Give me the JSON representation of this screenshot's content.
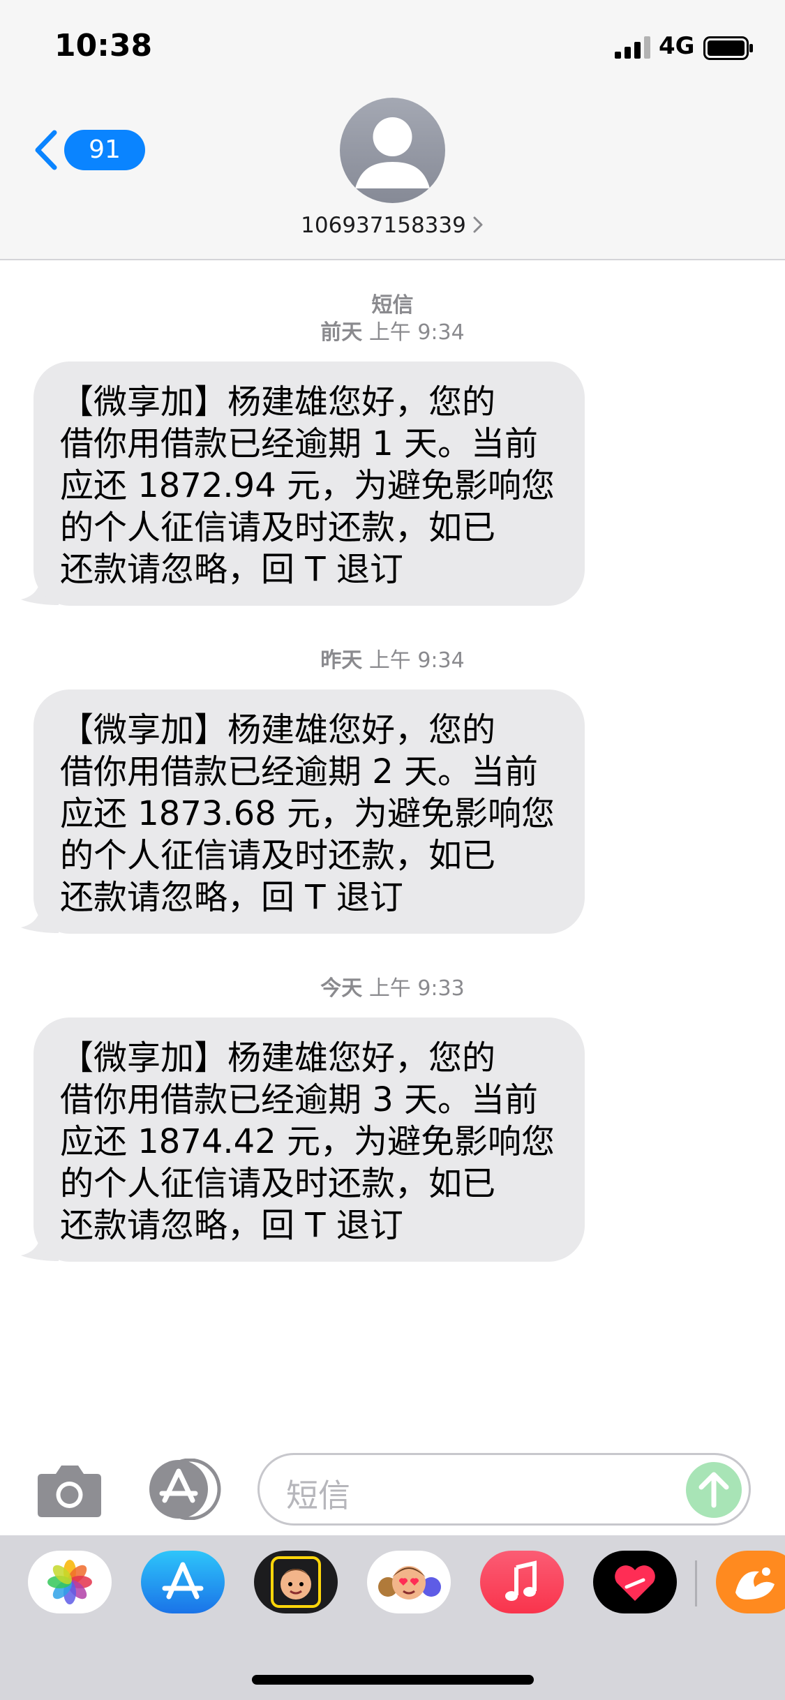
{
  "status_bar": {
    "time": "10:38",
    "network": "4G"
  },
  "nav": {
    "back_count": "91",
    "contact": "106937158339"
  },
  "thread": {
    "service_label": "短信",
    "messages": [
      {
        "day": "前天",
        "time": "上午 9:34",
        "lines": [
          "【微享加】杨建雄您好，您的",
          "借你用借款已经逾期 1 天。当前",
          "应还 1872.94 元，为避免影响您",
          "的个人征信请及时还款，如已",
          "还款请忽略，回 T 退订"
        ]
      },
      {
        "day": "昨天",
        "time": "上午 9:34",
        "lines": [
          "【微享加】杨建雄您好，您的",
          "借你用借款已经逾期 2 天。当前",
          "应还 1873.68 元，为避免影响您",
          "的个人征信请及时还款，如已",
          "还款请忽略，回 T 退订"
        ]
      },
      {
        "day": "今天",
        "time": "上午 9:33",
        "lines": [
          "【微享加】杨建雄您好，您的",
          "借你用借款已经逾期 3 天。当前",
          "应还 1874.42 元，为避免影响您",
          "的个人征信请及时还款，如已",
          "还款请忽略，回 T 退订"
        ]
      }
    ]
  },
  "compose": {
    "placeholder": "短信"
  },
  "app_drawer": {
    "apps": [
      "photos-icon",
      "app-store-icon",
      "memoji-camera-icon",
      "animoji-icon",
      "music-icon",
      "digital-touch-icon",
      "uc-browser-icon"
    ]
  },
  "colors": {
    "accent": "#0a84ff",
    "bubble": "#e9e9eb",
    "send": "#a8e4b6",
    "meta_text": "#8a8a8e"
  }
}
